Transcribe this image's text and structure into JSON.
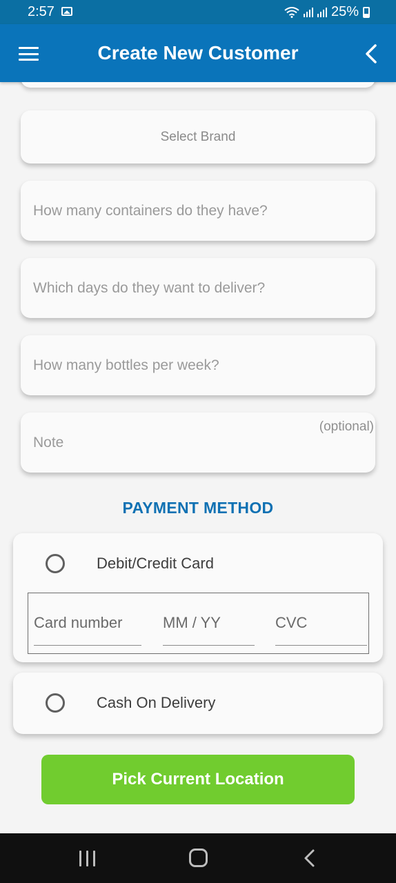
{
  "status_bar": {
    "time": "2:57",
    "battery": "25%",
    "icons": [
      "image-icon",
      "wifi-icon",
      "signal-icon",
      "signal-icon",
      "battery-icon"
    ]
  },
  "app_bar": {
    "title": "Create New Customer",
    "left_icon": "menu-icon",
    "right_icon": "back-chevron-icon",
    "color": "#0a74ba"
  },
  "form": {
    "brand_select": "Select Brand",
    "fields": [
      {
        "placeholder": "How many containers do they have?"
      },
      {
        "placeholder": "Which days do they want to deliver?"
      },
      {
        "placeholder": "How many bottles per week?"
      }
    ],
    "note": {
      "placeholder": "Note",
      "hint": "(optional)"
    }
  },
  "payment": {
    "title": "PAYMENT METHOD",
    "title_color": "#1071b3",
    "options": [
      {
        "label": "Debit/Credit Card",
        "selected": false
      },
      {
        "label": "Cash On Delivery",
        "selected": false
      }
    ],
    "card": {
      "number_placeholder": "Card number",
      "expiry_placeholder": "MM / YY",
      "cvc_placeholder": "CVC"
    }
  },
  "actions": {
    "pick_location": "Pick Current Location",
    "button_color": "#71cc2f"
  },
  "nav_bar": {
    "icons": [
      "recent-apps-icon",
      "home-icon",
      "back-icon"
    ]
  }
}
